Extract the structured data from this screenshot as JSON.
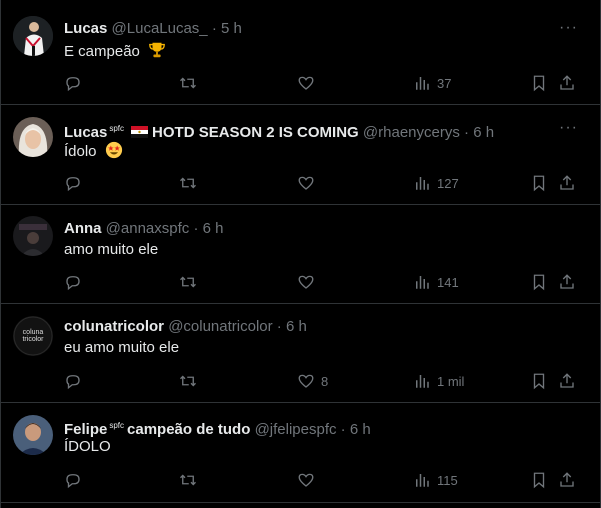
{
  "tweets": [
    {
      "name": "Lucas",
      "badge": "",
      "extra": "",
      "handle": "@LucaLucas_",
      "dot": "·",
      "time": "5 h",
      "text": "E campeão",
      "emoji": "trophy-emoji",
      "replies": "",
      "retweets": "",
      "likes": "",
      "views": "37"
    },
    {
      "name": "Lucas",
      "badge": "spfc",
      "extra": "HOTD SEASON 2 IS COMING",
      "handle": "@rhaenycerys",
      "dot": "·",
      "time": "6 h",
      "text": "Ídolo",
      "emoji": "star-struck-emoji",
      "replies": "",
      "retweets": "",
      "likes": "",
      "views": "127"
    },
    {
      "name": "Anna",
      "badge": "",
      "extra": "",
      "handle": "@annaxspfc",
      "dot": "·",
      "time": "6 h",
      "text": "amo muito ele",
      "emoji": "",
      "replies": "",
      "retweets": "",
      "likes": "",
      "views": "141"
    },
    {
      "name": "colunatricolor",
      "badge": "",
      "extra": "",
      "handle": "@colunatricolor",
      "dot": "·",
      "time": "6 h",
      "text": "eu amo muito ele",
      "emoji": "",
      "replies": "",
      "retweets": "",
      "likes": "8",
      "views": "1 mil"
    },
    {
      "name": "Felipe",
      "badge": "spfc",
      "extra": "campeão de tudo",
      "handle": "@jfelipespfc",
      "dot": "·",
      "time": "6 h",
      "text": "ÍDOLO",
      "emoji": "",
      "replies": "",
      "retweets": "",
      "likes": "",
      "views": "115"
    }
  ],
  "more_label": "···",
  "avatar_text_coluna": "coluna tricolor",
  "colors": {
    "background": "#000000",
    "text": "#e7e9ea",
    "muted": "#71767b",
    "divider": "#2f3336"
  }
}
